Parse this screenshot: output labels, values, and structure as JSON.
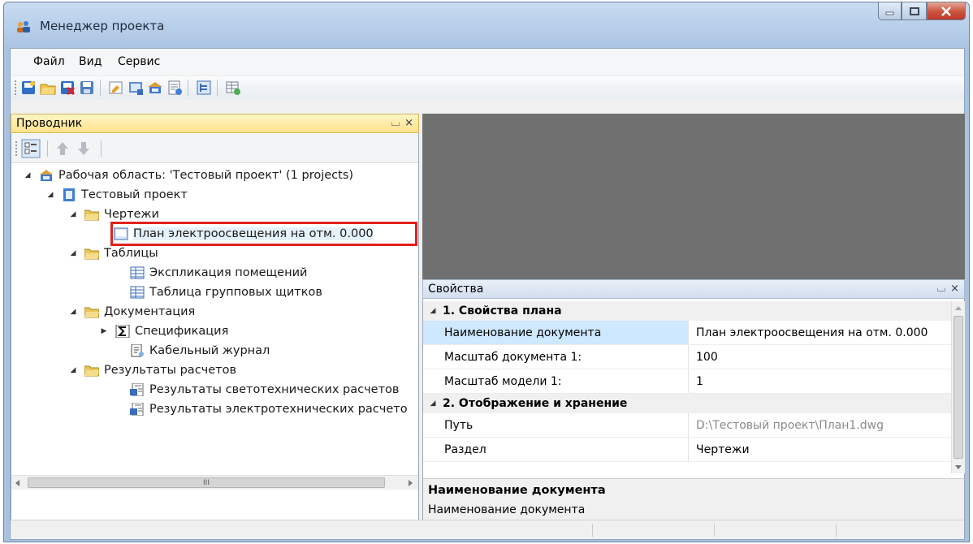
{
  "window": {
    "title": "Менеджер проекта"
  },
  "menu": {
    "items": [
      "Файл",
      "Вид",
      "Сервис"
    ]
  },
  "explorer": {
    "title": "Проводник",
    "pin": "⌴",
    "close": "×",
    "tree": [
      {
        "label": "Рабочая область: 'Тестовый проект' (1 projects)",
        "icon": "workspace-icon"
      },
      {
        "label": "Тестовый проект",
        "icon": "project-icon"
      },
      {
        "label": "Чертежи",
        "icon": "folder-icon"
      },
      {
        "label": "План электроосвещения на отм. 0.000",
        "icon": "drawing-icon"
      },
      {
        "label": "Таблицы",
        "icon": "folder-icon"
      },
      {
        "label": "Экспликация помещений",
        "icon": "table-icon"
      },
      {
        "label": "Таблица групповых щитков",
        "icon": "table-icon"
      },
      {
        "label": "Документация",
        "icon": "folder-icon"
      },
      {
        "label": "Спецификация",
        "icon": "sigma-icon"
      },
      {
        "label": "Кабельный журнал",
        "icon": "journal-icon"
      },
      {
        "label": "Результаты расчетов",
        "icon": "folder-icon"
      },
      {
        "label": "Результаты светотехнических расчетов",
        "icon": "report-icon"
      },
      {
        "label": "Результаты электротехнических расчето",
        "icon": "report-icon"
      }
    ]
  },
  "properties": {
    "title": "Свойства",
    "pin": "⌴",
    "close": "×",
    "categories": [
      "1. Свойства плана",
      "2. Отображение и хранение"
    ],
    "rows": [
      {
        "key": "Наименование документа",
        "value": "План электроосвещения на отм. 0.000"
      },
      {
        "key": "Масштаб документа 1:",
        "value": "100"
      },
      {
        "key": "Масштаб модели 1:",
        "value": "1"
      },
      {
        "key": "Путь",
        "value": "D:\\Тестовый проект\\План1.dwg"
      },
      {
        "key": "Раздел",
        "value": "Чертежи"
      }
    ],
    "description": {
      "title": "Наименование документа",
      "text": "Наименование документа"
    }
  },
  "scroll": {
    "hthumb": "III"
  },
  "colors": {
    "accent_header": "#ffe28a",
    "selection_outline": "#e0211e",
    "doc_area": "#707070"
  }
}
